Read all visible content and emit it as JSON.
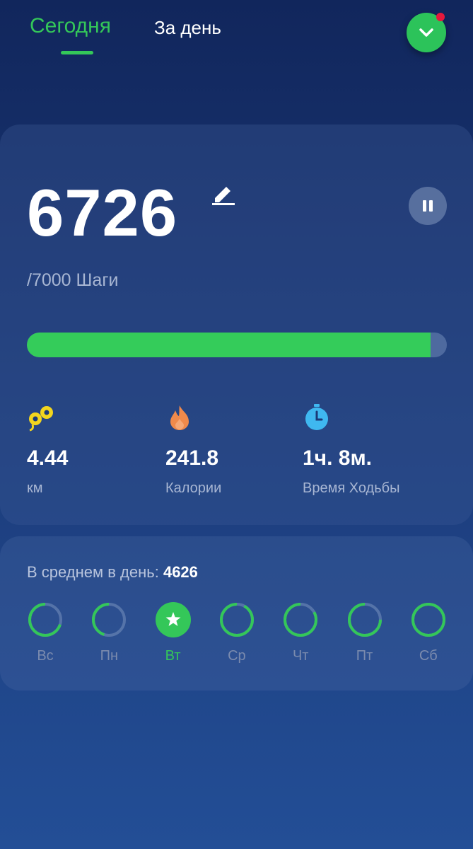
{
  "tabs": [
    {
      "label": "Сегодня",
      "active": true
    },
    {
      "label": "За день",
      "active": false
    }
  ],
  "colors": {
    "accent": "#34c759",
    "progress": "#34cc5a",
    "notification": "#e5193c",
    "distance_icon": "#f2d51e",
    "calories_icon": "#f08a4b",
    "time_icon": "#3fb8f0"
  },
  "summary": {
    "steps": "6726",
    "goal_text": "/7000 Шаги",
    "progress_fraction": 0.961,
    "edit_icon": "pencil-icon",
    "pause_icon": "pause-icon"
  },
  "stats": [
    {
      "icon": "distance-icon",
      "value": "4.44",
      "label": "км"
    },
    {
      "icon": "flame-icon",
      "value": "241.8",
      "label": "Калории"
    },
    {
      "icon": "stopwatch-icon",
      "value": "1ч. 8м.",
      "label": "Время Ходьбы"
    }
  ],
  "weekly": {
    "average_label": "В среднем в день:",
    "average_value": "4626",
    "days": [
      {
        "label": "Вс",
        "progress": 0.7,
        "achieved": false
      },
      {
        "label": "Пн",
        "progress": 0.45,
        "achieved": false
      },
      {
        "label": "Вт",
        "progress": 1.0,
        "achieved": true
      },
      {
        "label": "Ср",
        "progress": 0.92,
        "achieved": false
      },
      {
        "label": "Чт",
        "progress": 0.83,
        "achieved": false
      },
      {
        "label": "Пт",
        "progress": 0.75,
        "achieved": false
      },
      {
        "label": "Сб",
        "progress": 1.0,
        "achieved": false
      }
    ]
  }
}
